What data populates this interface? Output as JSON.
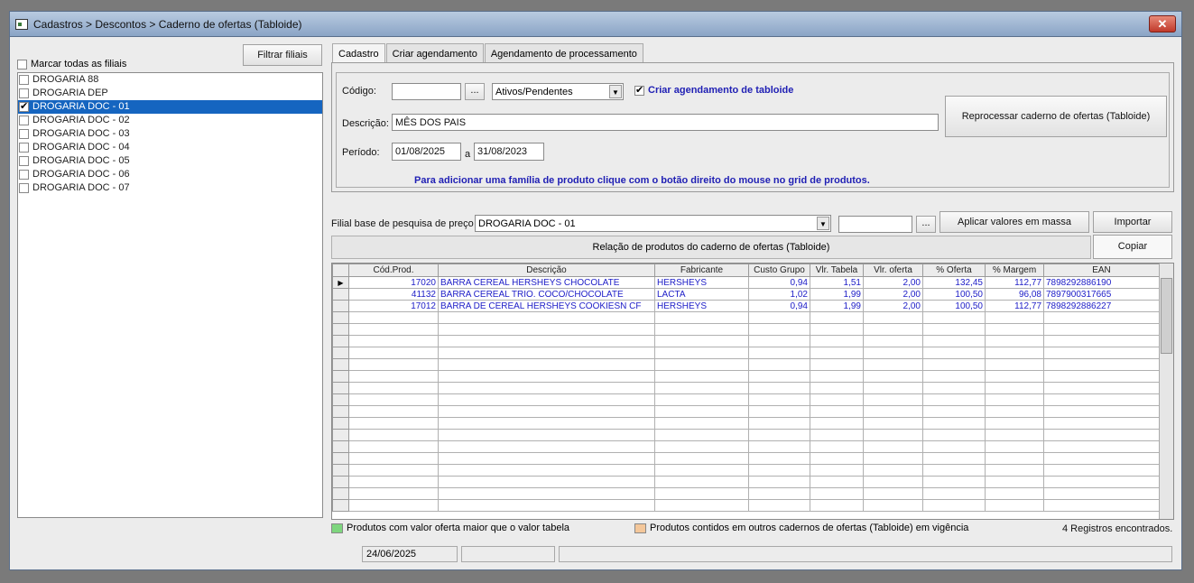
{
  "window": {
    "title": "Cadastros > Descontos > Caderno de ofertas (Tabloide)",
    "close": "✕"
  },
  "left": {
    "filter_button": "Filtrar filiais",
    "mark_all": "Marcar todas as filiais",
    "branches": [
      {
        "name": "DROGARIA 88",
        "checked": false,
        "selected": false
      },
      {
        "name": "DROGARIA DEP",
        "checked": false,
        "selected": false
      },
      {
        "name": "DROGARIA DOC - 01",
        "checked": true,
        "selected": true
      },
      {
        "name": "DROGARIA DOC - 02",
        "checked": false,
        "selected": false
      },
      {
        "name": "DROGARIA DOC - 03",
        "checked": false,
        "selected": false
      },
      {
        "name": "DROGARIA DOC - 04",
        "checked": false,
        "selected": false
      },
      {
        "name": "DROGARIA DOC - 05",
        "checked": false,
        "selected": false
      },
      {
        "name": "DROGARIA DOC - 06",
        "checked": false,
        "selected": false
      },
      {
        "name": "DROGARIA DOC - 07",
        "checked": false,
        "selected": false
      }
    ]
  },
  "tabs": [
    "Cadastro",
    "Criar agendamento",
    "Agendamento de processamento"
  ],
  "form": {
    "codigo_label": "Código:",
    "codigo_value": "",
    "ellipsis": "...",
    "status_select": "Ativos/Pendentes",
    "criar_label": "Criar agendamento de tabloide",
    "descricao_label": "Descrição:",
    "descricao_value": "MÊS DOS PAIS",
    "periodo_label": "Período:",
    "periodo_start": "01/08/2025",
    "periodo_sep": "a",
    "periodo_end": "31/08/2023",
    "reprocess_button": "Reprocessar caderno de ofertas (Tabloide)",
    "hint": "Para adicionar uma família de produto clique com o botão direito do  mouse no grid de produtos."
  },
  "pricing": {
    "label": "Filial base de pesquisa de preço",
    "branch": "DROGARIA DOC - 01",
    "value": "",
    "ellipsis": "...",
    "apply_button": "Aplicar valores em massa",
    "import_button": "Importar",
    "copy_button": "Copiar",
    "relation_title": "Relação de produtos do caderno de ofertas (Tabloide)"
  },
  "grid": {
    "columns": [
      "Cód.Prod.",
      "Descrição",
      "Fabricante",
      "Custo Grupo",
      "Vlr. Tabela",
      "Vlr. oferta",
      "% Oferta",
      "% Margem",
      "EAN"
    ],
    "rows": [
      [
        "17020",
        "BARRA CEREAL HERSHEYS CHOCOLATE",
        "HERSHEYS",
        "0,94",
        "1,51",
        "2,00",
        "132,45",
        "112,77",
        "7898292886190"
      ],
      [
        "41132",
        "BARRA CEREAL TRIO. COCO/CHOCOLATE",
        "LACTA",
        "1,02",
        "1,99",
        "2,00",
        "100,50",
        "96,08",
        "7897900317665"
      ],
      [
        "17012",
        "BARRA DE CEREAL HERSHEYS COOKIESN CF",
        "HERSHEYS",
        "0,94",
        "1,99",
        "2,00",
        "100,50",
        "112,77",
        "7898292886227"
      ]
    ],
    "empty_rows": 17
  },
  "legend": {
    "green_text": "Produtos com valor oferta maior que o valor tabela",
    "green_color": "#7ed67e",
    "orange_text": "Produtos contidos em outros cadernos de ofertas (Tabloide) em vigência",
    "orange_color": "#f4c79a",
    "count": "4 Registros encontrados."
  },
  "statusbar": {
    "date": "24/06/2025"
  }
}
